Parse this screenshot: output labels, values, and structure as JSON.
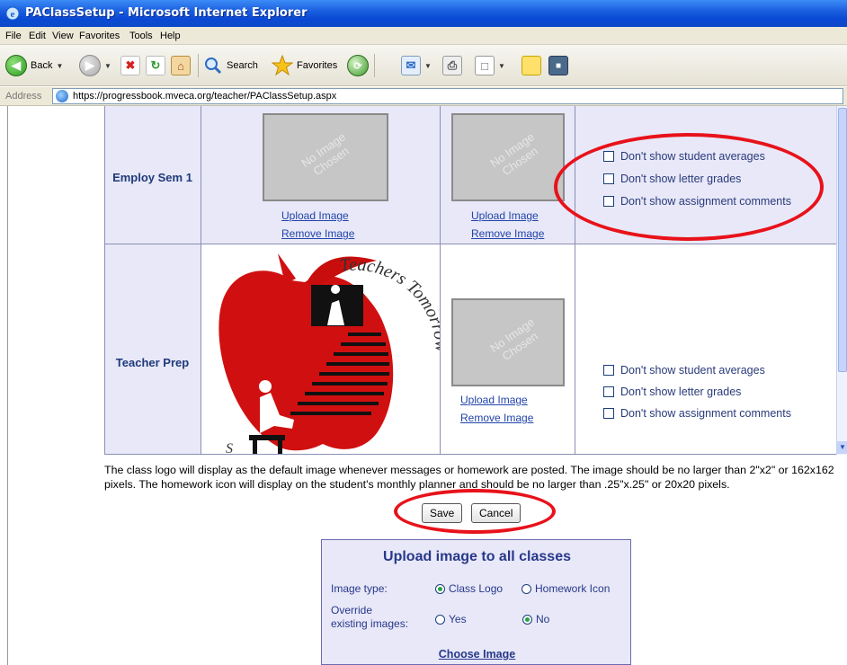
{
  "window": {
    "title": "PAClassSetup - Microsoft Internet Explorer"
  },
  "menu": [
    "File",
    "Edit",
    "View",
    "Favorites",
    "Tools",
    "Help"
  ],
  "toolbar": {
    "back": "Back",
    "search": "Search",
    "favorites": "Favorites"
  },
  "address": {
    "label": "Address",
    "url": "https://progressbook.mveca.org/teacher/PAClassSetup.aspx"
  },
  "classes": [
    {
      "name": "Employ Sem 1",
      "logo_placeholder": "No Image Chosen",
      "icon_placeholder": "No Image Chosen",
      "upload_label": "Upload Image",
      "remove_label": "Remove Image",
      "options": [
        "Don't show student averages",
        "Don't show letter grades",
        "Don't show assignment comments"
      ]
    },
    {
      "name": "Teacher Prep",
      "logo_text": "Teachers Tomorrow",
      "icon_placeholder": "No Image Chosen",
      "upload_label": "Upload Image",
      "remove_label": "Remove Image",
      "options": [
        "Don't show student averages",
        "Don't show letter grades",
        "Don't show assignment comments"
      ]
    }
  ],
  "description": "The class logo will display as the default image whenever messages or homework are posted. The image should be no larger than 2\"x2\" or 162x162 pixels. The homework icon will display on the student's monthly planner and should be no larger than .25\"x.25\" or 20x20 pixels.",
  "buttons": {
    "save": "Save",
    "cancel": "Cancel"
  },
  "upload_all": {
    "heading": "Upload image to all classes",
    "image_type_label": "Image type:",
    "image_type_options": [
      "Class Logo",
      "Homework Icon"
    ],
    "image_type_selected": "Class Logo",
    "override_label_1": "Override",
    "override_label_2": "existing images:",
    "override_options": [
      "Yes",
      "No"
    ],
    "override_selected": "No",
    "choose_label": "Choose Image"
  },
  "colors": {
    "accent": "#27388a",
    "highlight": "#e8121a",
    "row_alt": "#e8e8f8"
  }
}
